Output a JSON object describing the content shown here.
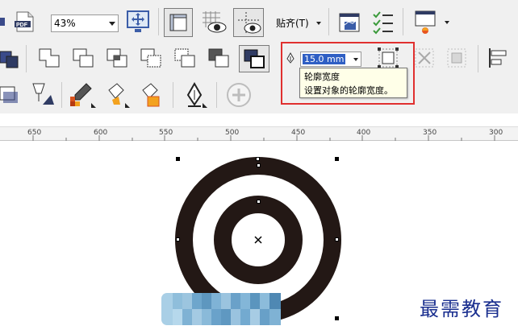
{
  "toolbar": {
    "zoom_value": "43%",
    "snap_label": "贴齐(T)",
    "outline_width_value": "15.0 mm"
  },
  "tooltip": {
    "title": "轮廓宽度",
    "description": "设置对象的轮廓宽度。"
  },
  "ruler": {
    "labels": [
      "650",
      "600",
      "550",
      "500",
      "450",
      "400",
      "350",
      "300"
    ]
  },
  "watermark": "最需教育",
  "colors": {
    "highlight_box": "#e0302f",
    "target_rings": "#231815",
    "selected_text_bg": "#2f5fc4",
    "tooltip_bg": "#ffffe8"
  }
}
